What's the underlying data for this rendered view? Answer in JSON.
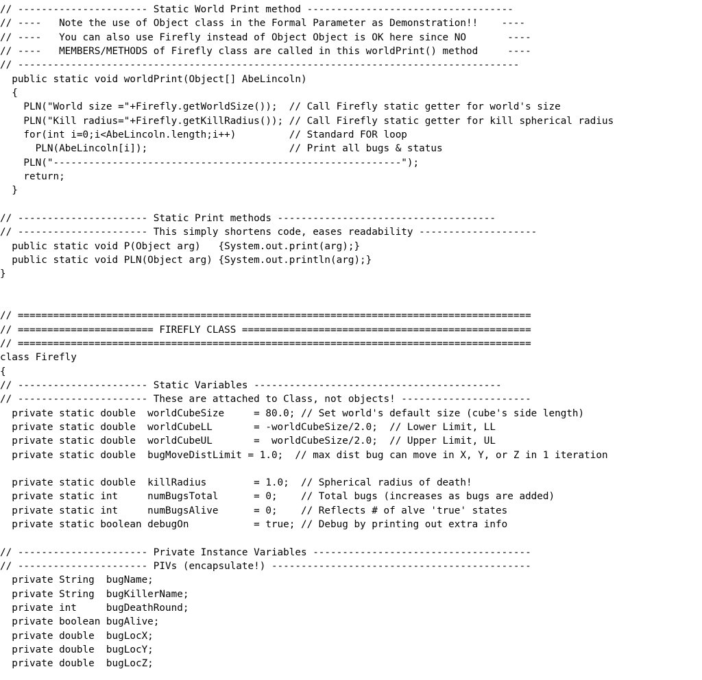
{
  "document": {
    "kind": "source-code-listing",
    "language": "Java",
    "background_color": "#ffffff",
    "text_color": "#000000",
    "font_style": "monospace",
    "total_lines": 49
  },
  "code": {
    "lines": [
      "// ---------------------- Static World Print method -----------------------------------",
      "// ----   Note the use of Object class in the Formal Parameter as Demonstration!!    ----",
      "// ----   You can also use Firefly instead of Object Object is OK here since NO       ----",
      "// ----   MEMBERS/METHODS of Firefly class are called in this worldPrint() method     ----",
      "// -------------------------------------------------------------------------------------",
      "  public static void worldPrint(Object[] AbeLincoln)",
      "  {",
      "    PLN(\"World size =\"+Firefly.getWorldSize());  // Call Firefly static getter for world's size",
      "    PLN(\"Kill radius=\"+Firefly.getKillRadius()); // Call Firefly static getter for kill spherical radius",
      "    for(int i=0;i<AbeLincoln.length;i++)         // Standard FOR loop",
      "      PLN(AbeLincoln[i]);                        // Print all bugs & status",
      "    PLN(\"-----------------------------------------------------------\");",
      "    return;",
      "  }",
      "",
      "// ---------------------- Static Print methods -------------------------------------",
      "// ---------------------- This simply shortens code, eases readability --------------------",
      "  public static void P(Object arg)   {System.out.print(arg);}",
      "  public static void PLN(Object arg) {System.out.println(arg);}",
      "}",
      "",
      "",
      "// =======================================================================================",
      "// ======================= FIREFLY CLASS =================================================",
      "// =======================================================================================",
      "class Firefly",
      "{",
      "// ---------------------- Static Variables ------------------------------------------",
      "// ---------------------- These are attached to Class, not objects! ----------------------",
      "  private static double  worldCubeSize     = 80.0; // Set world's default size (cube's side length)",
      "  private static double  worldCubeLL       = -worldCubeSize/2.0;  // Lower Limit, LL",
      "  private static double  worldCubeUL       =  worldCubeSize/2.0;  // Upper Limit, UL",
      "  private static double  bugMoveDistLimit = 1.0;  // max dist bug can move in X, Y, or Z in 1 iteration",
      "",
      "  private static double  killRadius        = 1.0;  // Spherical radius of death!",
      "  private static int     numBugsTotal      = 0;    // Total bugs (increases as bugs are added)",
      "  private static int     numBugsAlive      = 0;    // Reflects # of alve 'true' states",
      "  private static boolean debugOn           = true; // Debug by printing out extra info",
      "",
      "// ---------------------- Private Instance Variables -------------------------------------",
      "// ---------------------- PIVs (encapsulate!) --------------------------------------------",
      "  private String  bugName;",
      "  private String  bugKillerName;",
      "  private int     bugDeathRound;",
      "  private boolean bugAlive;",
      "  private double  bugLocX;",
      "  private double  bugLocY;",
      "  private double  bugLocZ;"
    ]
  }
}
